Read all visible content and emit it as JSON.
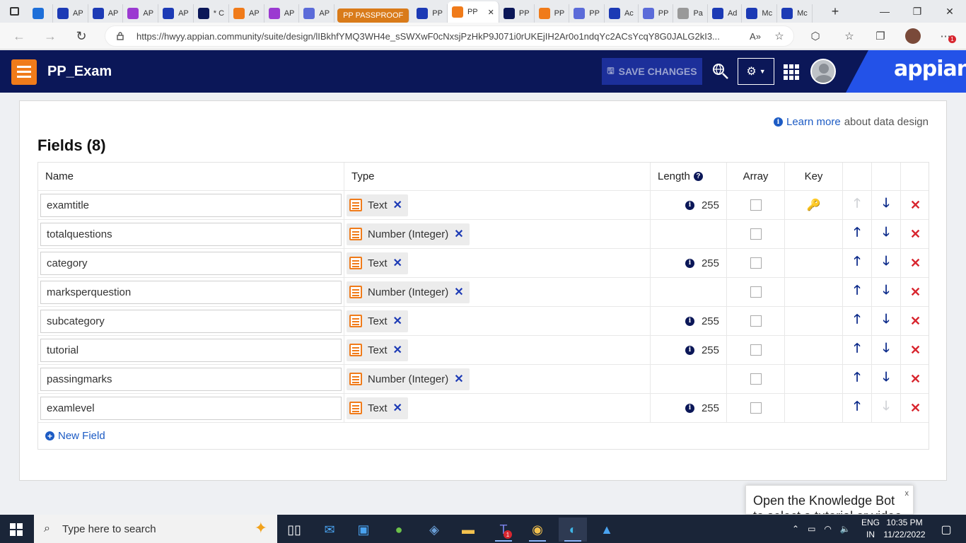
{
  "browser": {
    "tabs": [
      {
        "label": "",
        "icon": "edge-tab-icon",
        "color": "#1e6fd9"
      },
      {
        "label": "AP",
        "icon": "appian-a-icon",
        "color": "#1c3ab5"
      },
      {
        "label": "AP",
        "icon": "grid-icon",
        "color": "#1c3ab5"
      },
      {
        "label": "AP",
        "icon": "code-icon",
        "color": "#9b3ad1"
      },
      {
        "label": "AP",
        "icon": "grid-icon",
        "color": "#1c3ab5"
      },
      {
        "label": "* C",
        "icon": "link-icon",
        "color": "#0b1758"
      },
      {
        "label": "AP",
        "icon": "table-icon",
        "color": "#f07b1a"
      },
      {
        "label": "AP",
        "icon": "code-icon",
        "color": "#9b3ad1"
      },
      {
        "label": "AP",
        "icon": "list-icon",
        "color": "#5b6bd9"
      },
      {
        "label": "PP PASSPROOF",
        "icon": "group-label",
        "color": "#d97b1a"
      },
      {
        "label": "PP",
        "icon": "grid-icon",
        "color": "#1c3ab5"
      },
      {
        "label": "PP",
        "icon": "active-tab",
        "color": "#f07b1a"
      },
      {
        "label": "PP",
        "icon": "link-icon",
        "color": "#0b1758"
      },
      {
        "label": "PP",
        "icon": "table-icon",
        "color": "#f07b1a"
      },
      {
        "label": "PP",
        "icon": "list-icon",
        "color": "#5b6bd9"
      },
      {
        "label": "Ac",
        "icon": "appian-a-icon",
        "color": "#1c3ab5"
      },
      {
        "label": "PP",
        "icon": "list-icon",
        "color": "#5b6bd9"
      },
      {
        "label": "Pa",
        "icon": "image-icon",
        "color": "#999999"
      },
      {
        "label": "Ad",
        "icon": "appian-a-icon",
        "color": "#1c3ab5"
      },
      {
        "label": "Mc",
        "icon": "appian-a-icon",
        "color": "#1c3ab5"
      },
      {
        "label": "Mc",
        "icon": "appian-a-icon",
        "color": "#1c3ab5"
      }
    ],
    "url": "https://hwyy.appian.community/suite/design/lIBkhfYMQ3WH4e_sSWXwF0cNxsjPzHkP9J071i0rUKEjIH2Ar0o1ndqYc2ACsYcqY8G0JALG2kI3...",
    "new_tab": "+",
    "minimize": "—",
    "restore": "❐",
    "close": "✕",
    "extension_badge": "1"
  },
  "app": {
    "title": "PP_Exam",
    "save_label": "SAVE CHANGES",
    "brand": "appian",
    "accent": "#f07b1a",
    "header_bg": "#0b1758"
  },
  "content": {
    "learn_link": "Learn more",
    "learn_suffix": "about data design",
    "fields_title": "Fields (8)",
    "columns": {
      "name": "Name",
      "type": "Type",
      "length": "Length",
      "array": "Array",
      "key": "Key"
    },
    "fields": [
      {
        "name": "examtitle",
        "type": "Text",
        "length": "255",
        "is_key": true
      },
      {
        "name": "totalquestions",
        "type": "Number (Integer)",
        "length": "",
        "is_key": false
      },
      {
        "name": "category",
        "type": "Text",
        "length": "255",
        "is_key": false
      },
      {
        "name": "marksperquestion",
        "type": "Number (Integer)",
        "length": "",
        "is_key": false
      },
      {
        "name": "subcategory",
        "type": "Text",
        "length": "255",
        "is_key": false
      },
      {
        "name": "tutorial",
        "type": "Text",
        "length": "255",
        "is_key": false
      },
      {
        "name": "passingmarks",
        "type": "Number (Integer)",
        "length": "",
        "is_key": false
      },
      {
        "name": "examlevel",
        "type": "Text",
        "length": "255",
        "is_key": false
      }
    ],
    "new_field": "New Field"
  },
  "knowledge_bot": {
    "text": "Open the Knowledge Bot to select a tutorial or video",
    "close": "x"
  },
  "taskbar": {
    "search_placeholder": "Type here to search",
    "lang_line1": "ENG",
    "lang_line2": "IN",
    "time": "10:35 PM",
    "date": "11/22/2022",
    "teams_badge": "1"
  }
}
